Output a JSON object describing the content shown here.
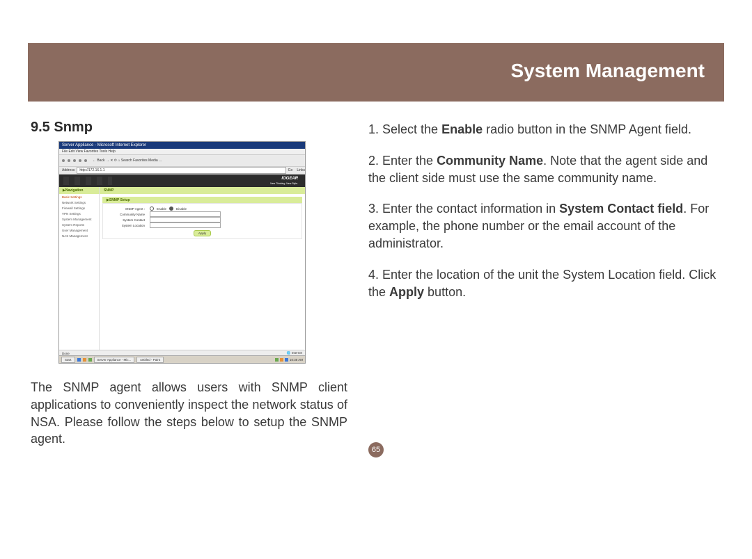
{
  "header": {
    "title": "System Management"
  },
  "section": {
    "heading": "9.5 Snmp"
  },
  "screenshot": {
    "window_title": "Server Appliance - Microsoft Internet Explorer",
    "menu": "File  Edit  View  Favorites  Tools  Help",
    "toolbar": "← Back  →  ✕  ⟳  ⌂   Search  Favorites  Media  ...",
    "address_label": "Address",
    "address_value": "http://172.16.1.1",
    "go_label": "Go",
    "links_label": "Links",
    "brand": "IOGEAR",
    "brand_tag": "New Thinking. New Style.",
    "nav_header": "Navigation",
    "nav_items": [
      "Basic Settings",
      "Network Settings",
      "Firewall Settings",
      "VPN Settings",
      "System Management",
      "System Reports",
      "User Management",
      "NAS Management"
    ],
    "main_header": "SNMP",
    "panel_header": "SNMP Setup",
    "row_agent_label": "SNMP Agent :",
    "row_agent_enable": "Enable",
    "row_agent_disable": "Disable",
    "row_community": "Community Name",
    "row_contact": "System Contact",
    "row_location": "System Location",
    "apply": "Apply",
    "status_left": "Done",
    "status_right": "Internet",
    "taskbar_start": "Start",
    "taskbar_app1": "Server Appliance - Mic...",
    "taskbar_app2": "untitled - Paint",
    "taskbar_time": "10:35 AM"
  },
  "para": "The SNMP agent allows users with SNMP client applications to conveniently inspect the network status of NSA. Please follow the steps below to setup the SNMP agent.",
  "steps": {
    "s1a": "1. Select the ",
    "s1b": "Enable",
    "s1c": " radio button in the SNMP Agent field.",
    "s2a": "2. Enter the ",
    "s2b": "Community Name",
    "s2c": ". Note that the agent side and the client side must use the same community name.",
    "s3a": "3. Enter the contact information in ",
    "s3b": "System Contact field",
    "s3c": ". For example, the phone number or the email account of the administrator.",
    "s4a": "4. Enter the location of the unit the System Location field. Click the ",
    "s4b": "Apply",
    "s4c": " button."
  },
  "page_number": "65"
}
